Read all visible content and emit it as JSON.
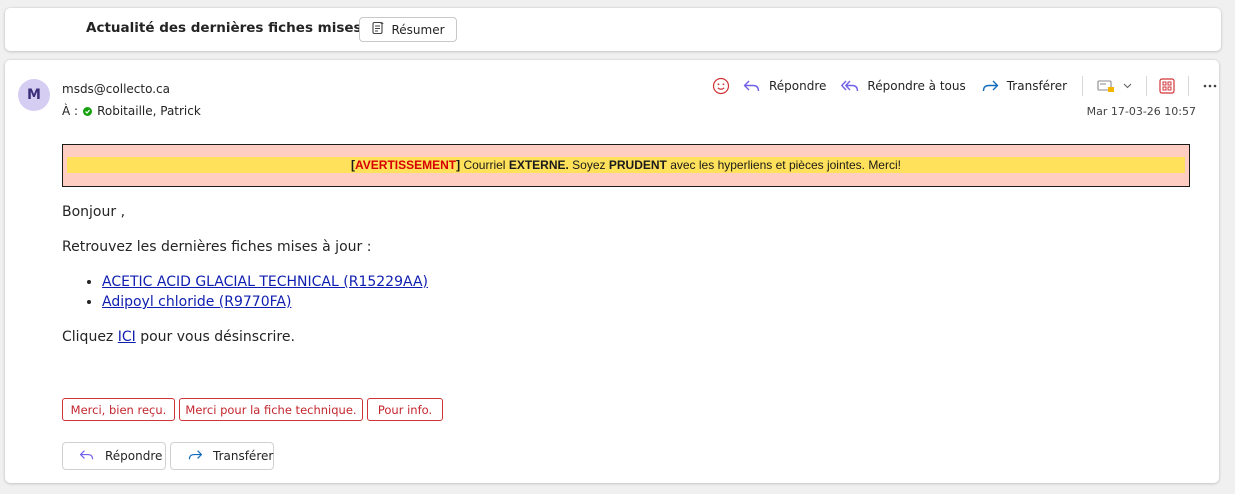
{
  "header": {
    "subject": "Actualité des dernières fiches mises à jour",
    "summarize_label": "Résumer"
  },
  "message": {
    "avatar_initial": "M",
    "sender": "msds@collecto.ca",
    "to_label": "À :",
    "recipient": "Robitaille, Patrick",
    "date": "Mar 17-03-26 10:57"
  },
  "toolbar": {
    "reply": "Répondre",
    "reply_all": "Répondre à tous",
    "forward": "Transférer"
  },
  "warning": {
    "open_bracket": "[",
    "tag": "AVERTISSEMENT",
    "close_bracket": "]",
    "part1": " Courriel ",
    "word1": "EXTERNE.",
    "part2": " Soyez ",
    "word2": "PRUDENT",
    "part3": " avec les hyperliens et pièces jointes. Merci!"
  },
  "body": {
    "greeting": "Bonjour ,",
    "intro": "Retrouvez les dernières fiches mises à jour :",
    "links": [
      "ACETIC ACID GLACIAL TECHNICAL (R15229AA)",
      "Adipoyl chloride (R9770FA)"
    ],
    "unsub_before": "Cliquez ",
    "unsub_link": "ICI",
    "unsub_after": " pour vous désinscrire."
  },
  "quick_replies": [
    "Merci, bien reçu.",
    "Merci pour la fiche technique.",
    "Pour info."
  ],
  "bottom": {
    "reply": "Répondre",
    "forward": "Transférer"
  },
  "colors": {
    "accent_purple": "#7160e8",
    "forward_blue": "#0f6cbd",
    "warning_bg": "#ffcdc2",
    "warning_strip": "#ffe15c",
    "quick_red": "#d13438",
    "link": "#0f1eb0"
  }
}
